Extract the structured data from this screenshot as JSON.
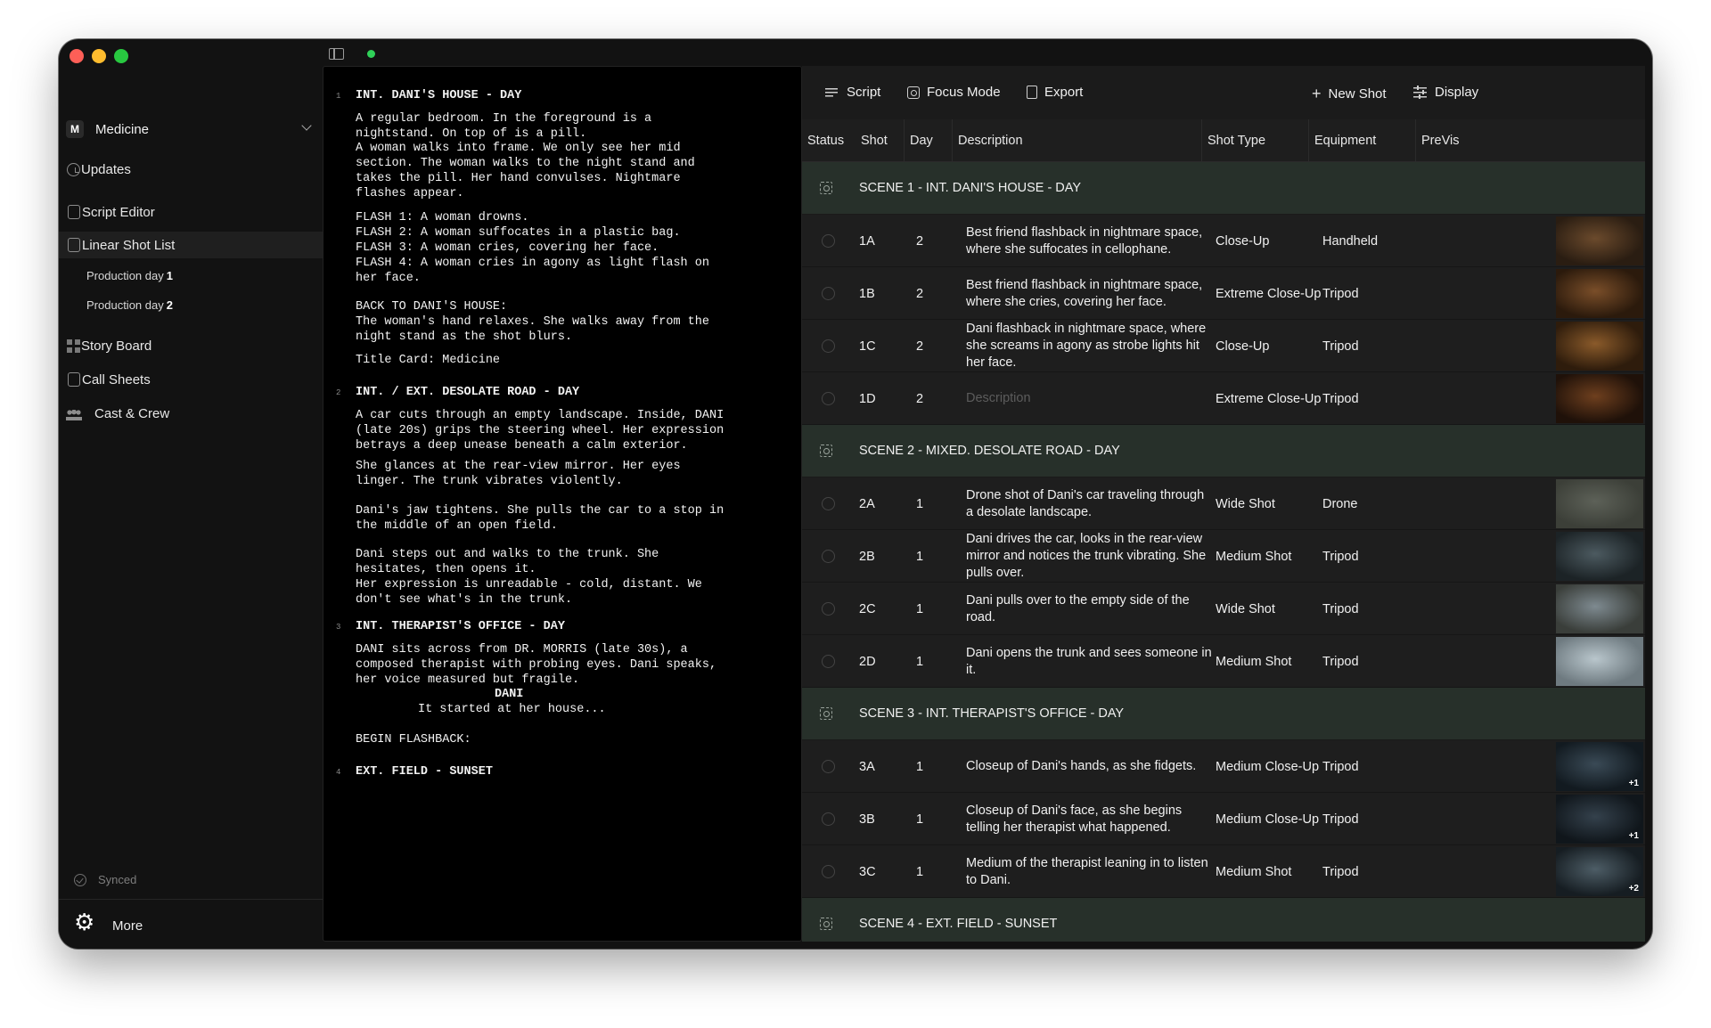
{
  "workspace": {
    "initial": "M",
    "name": "Medicine"
  },
  "sidebar": {
    "items": [
      {
        "label": "Updates"
      },
      {
        "label": "Script Editor"
      },
      {
        "label": "Linear Shot List"
      },
      {
        "label": "Story Board"
      },
      {
        "label": "Call Sheets"
      },
      {
        "label": "Cast & Crew"
      }
    ],
    "production_days": [
      {
        "label": "Production day",
        "num": "1"
      },
      {
        "label": "Production day",
        "num": "2"
      }
    ],
    "synced": "Synced",
    "more": "More"
  },
  "script": {
    "lines": [
      {
        "n": "1",
        "text": "INT. DANI'S HOUSE - DAY",
        "slug": true
      },
      {
        "text": "A regular bedroom. In the foreground is a"
      },
      {
        "text": "nightstand. On top of is a pill."
      },
      {
        "text": "A woman walks into frame. We only see her mid"
      },
      {
        "text": "section. The woman walks to the night stand and"
      },
      {
        "text": "takes the pill. Her hand convulses. Nightmare"
      },
      {
        "text": "flashes appear."
      },
      {
        "text": "FLASH 1: A woman drowns."
      },
      {
        "text": "FLASH 2: A woman suffocates in a plastic bag."
      },
      {
        "text": "FLASH 3: A woman cries, covering her face."
      },
      {
        "text": "FLASH 4: A woman cries in agony as light flash on"
      },
      {
        "text": "her face."
      },
      {
        "text": "BACK TO DANI'S HOUSE:"
      },
      {
        "text": "The woman's hand relaxes. She walks away from the"
      },
      {
        "text": "night stand as the shot blurs."
      },
      {
        "text": "Title Card: Medicine"
      },
      {
        "n": "2",
        "text": "INT. / EXT. DESOLATE ROAD - DAY",
        "slug": true
      },
      {
        "text": "A car cuts through an empty landscape. Inside, DANI"
      },
      {
        "text": "(late 20s) grips the steering wheel. Her expression"
      },
      {
        "text": "betrays a deep unease beneath a calm exterior."
      },
      {
        "text": "She glances at the rear-view mirror. Her eyes"
      },
      {
        "text": "linger. The trunk vibrates violently."
      },
      {
        "text": "Dani's jaw tightens. She pulls the car to a stop in"
      },
      {
        "text": "the middle of an open field."
      },
      {
        "text": "Dani steps out and walks to the trunk. She"
      },
      {
        "text": "hesitates, then opens it."
      },
      {
        "text": "Her expression is unreadable - cold, distant. We"
      },
      {
        "text": "don't see what's in the trunk."
      },
      {
        "n": "3",
        "text": "INT. THERAPIST'S OFFICE - DAY",
        "slug": true
      },
      {
        "text": "DANI sits across from DR. MORRIS (late 30s), a"
      },
      {
        "text": "composed therapist with probing eyes. Dani speaks,"
      },
      {
        "text": "her voice measured but fragile."
      },
      {
        "text": "DANI",
        "slug": true
      },
      {
        "text": "It started at her house..."
      },
      {
        "text": "BEGIN FLASHBACK:"
      },
      {
        "n": "4",
        "text": "EXT. FIELD - SUNSET",
        "slug": true
      }
    ]
  },
  "toolbar": {
    "script": "Script",
    "focus_mode": "Focus Mode",
    "export": "Export",
    "new_shot": "New Shot",
    "display": "Display"
  },
  "columns": [
    "Status",
    "Shot",
    "Day",
    "Description",
    "Shot Type",
    "Equipment",
    "PreVis"
  ],
  "scenes": [
    {
      "title": "SCENE 1 - INT. DANI'S HOUSE - DAY",
      "shots": [
        {
          "shot": "1A",
          "day": "2",
          "desc": "Best friend flashback in nightmare space, where she suffocates in cellophane.",
          "type": "Close-Up",
          "equip": "Handheld",
          "thumb": "#6b4a2c",
          "thumb2": "#2a1d12",
          "badge": ""
        },
        {
          "shot": "1B",
          "day": "2",
          "desc": "Best friend flashback in nightmare space, where she cries, covering her face.",
          "type": "Extreme Close-Up",
          "equip": "Tripod",
          "thumb": "#7a4e29",
          "thumb2": "#2b1a0c",
          "badge": ""
        },
        {
          "shot": "1C",
          "day": "2",
          "desc": "Dani flashback in nightmare space, where she screams in agony as strobe lights hit her face.",
          "type": "Close-Up",
          "equip": "Tripod",
          "thumb": "#8a5a2a",
          "thumb2": "#2e1c0c",
          "badge": ""
        },
        {
          "shot": "1D",
          "day": "2",
          "desc": "Description",
          "placeholder": true,
          "type": "Extreme Close-Up",
          "equip": "Tripod",
          "thumb": "#6e3f1e",
          "thumb2": "#1f1109",
          "badge": ""
        }
      ]
    },
    {
      "title": "SCENE 2 - MIXED. DESOLATE ROAD - DAY",
      "shots": [
        {
          "shot": "2A",
          "day": "1",
          "desc": "Drone shot of Dani's car traveling through a desolate landscape.",
          "type": "Wide Shot",
          "equip": "Drone",
          "thumb": "#5d6158",
          "thumb2": "#3c3f38",
          "badge": ""
        },
        {
          "shot": "2B",
          "day": "1",
          "desc": "Dani drives the car, looks in the rear-view mirror and notices the trunk vibrating. She pulls over.",
          "type": "Medium Shot",
          "equip": "Tripod",
          "thumb": "#4c5a60",
          "thumb2": "#1c2326",
          "badge": ""
        },
        {
          "shot": "2C",
          "day": "1",
          "desc": "Dani pulls over to the empty side of the road.",
          "type": "Wide Shot",
          "equip": "Tripod",
          "thumb": "#7e8a90",
          "thumb2": "#3a3e3a",
          "badge": ""
        },
        {
          "shot": "2D",
          "day": "1",
          "desc": "Dani opens the trunk and sees someone in it.",
          "type": "Medium Shot",
          "equip": "Tripod",
          "thumb": "#b9c6cc",
          "thumb2": "#6e7a80",
          "badge": ""
        }
      ]
    },
    {
      "title": "SCENE 3 - INT. THERAPIST'S OFFICE - DAY",
      "shots": [
        {
          "shot": "3A",
          "day": "1",
          "desc": "Closeup of Dani's hands, as she fidgets.",
          "type": "Medium Close-Up",
          "equip": "Tripod",
          "thumb": "#3a4a56",
          "thumb2": "#121a20",
          "badge": "+1"
        },
        {
          "shot": "3B",
          "day": "1",
          "desc": "Closeup of Dani's face, as she begins telling her therapist what happened.",
          "type": "Medium Close-Up",
          "equip": "Tripod",
          "thumb": "#34414c",
          "thumb2": "#10161b",
          "badge": "+1"
        },
        {
          "shot": "3C",
          "day": "1",
          "desc": "Medium of the therapist leaning in to listen to Dani.",
          "type": "Medium Shot",
          "equip": "Tripod",
          "thumb": "#4d5d66",
          "thumb2": "#161d22",
          "badge": "+2"
        }
      ]
    },
    {
      "title": "SCENE 4 - EXT. FIELD - SUNSET",
      "shots": []
    }
  ]
}
